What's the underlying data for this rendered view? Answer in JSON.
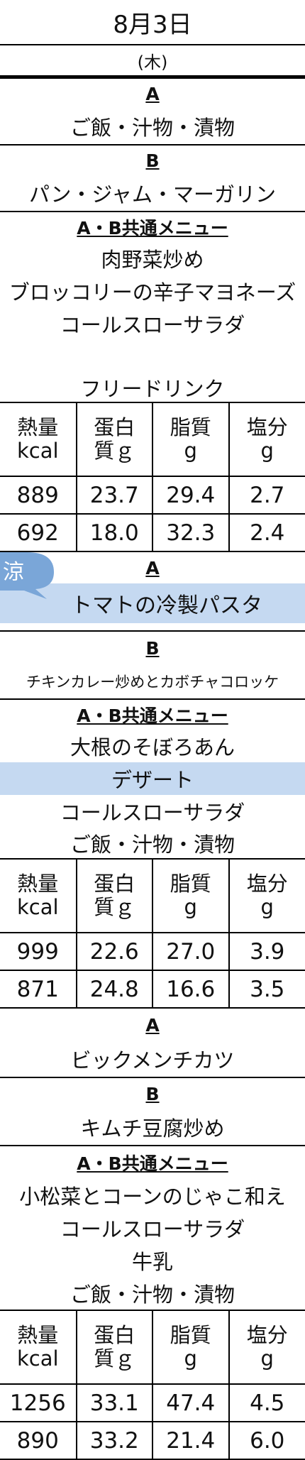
{
  "date": "8月3日",
  "weekday": "(木)",
  "nutrition_headers": [
    {
      "top": "熱量",
      "bottom": "kcal"
    },
    {
      "top": "蛋白",
      "bottom": "質ｇ"
    },
    {
      "top": "脂質",
      "bottom": "g"
    },
    {
      "top": "塩分",
      "bottom": "g"
    }
  ],
  "meals": [
    {
      "label_a": "A",
      "menu_a": "ご飯・汁物・漬物",
      "label_b": "B",
      "menu_b": "パン・ジャム・マーガリン",
      "common_label": "A・B共通メニュー",
      "common_items": [
        "肉野菜炒め",
        "ブロッコリーの辛子マヨネーズ",
        "コールスローサラダ",
        "フリードリンク"
      ],
      "values_a": [
        "889",
        "23.7",
        "29.4",
        "2.7"
      ],
      "values_b": [
        "692",
        "18.0",
        "32.3",
        "2.4"
      ]
    },
    {
      "badge": "涼",
      "badge_color": "#7aa6d8",
      "label_a": "A",
      "menu_a": "トマトの冷製パスタ",
      "label_b": "B",
      "menu_b": "チキンカレー炒めとカボチャコロッケ",
      "common_label": "A・B共通メニュー",
      "common_items": [
        "大根のそぼろあん",
        "デザート",
        "コールスローサラダ",
        "ご飯・汁物・漬物"
      ],
      "values_a": [
        "999",
        "22.6",
        "27.0",
        "3.9"
      ],
      "values_b": [
        "871",
        "24.8",
        "16.6",
        "3.5"
      ]
    },
    {
      "label_a": "A",
      "menu_a": "ビックメンチカツ",
      "label_b": "B",
      "menu_b": "キムチ豆腐炒め",
      "common_label": "A・B共通メニュー",
      "common_items": [
        "小松菜とコーンのじゃこ和え",
        "コールスローサラダ",
        "牛乳",
        "ご飯・汁物・漬物"
      ],
      "values_a": [
        "1256",
        "33.1",
        "47.4",
        "4.5"
      ],
      "values_b": [
        "890",
        "33.2",
        "21.4",
        "6.0"
      ]
    }
  ],
  "highlight_color": "#c5d9f1"
}
